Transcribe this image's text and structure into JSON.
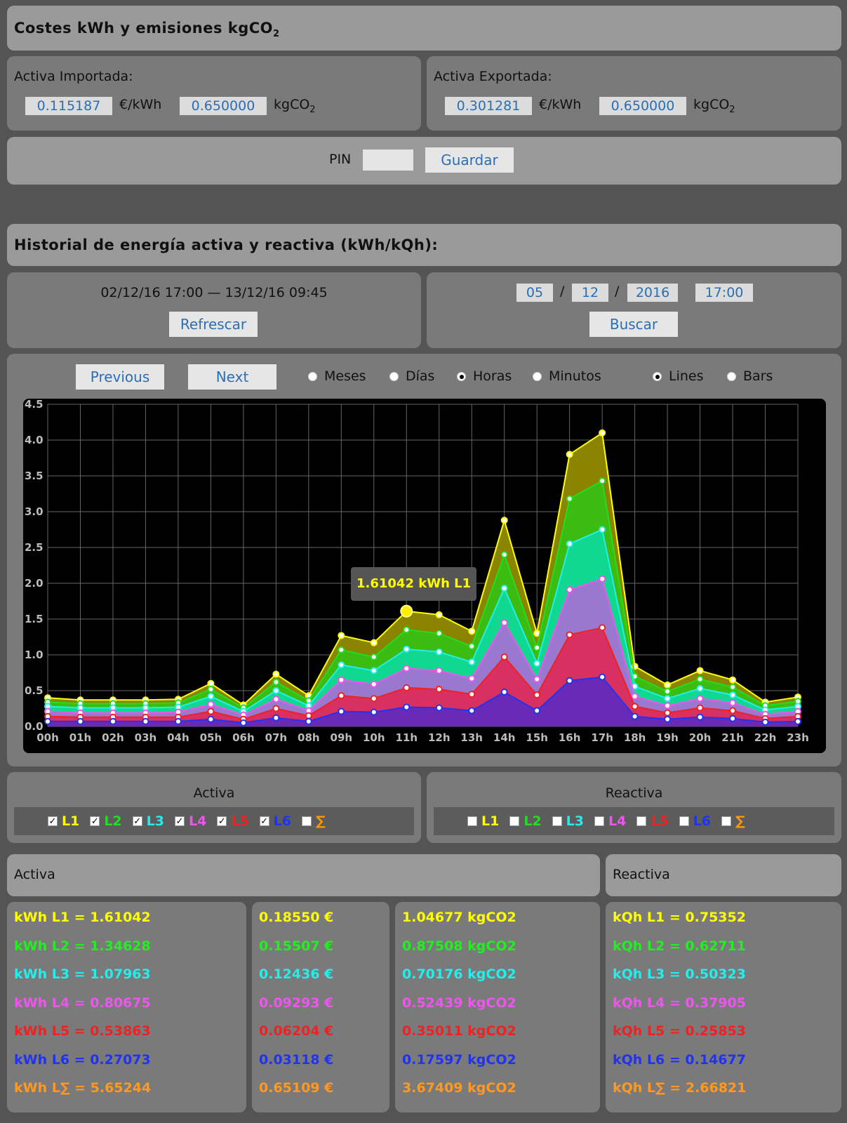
{
  "costes": {
    "title": "Costes kWh y emisiones kgCO",
    "title_sub": "2",
    "import_label": "Activa Importada:",
    "import_price": "0.115187",
    "import_co2": "0.650000",
    "export_label": "Activa Exportada:",
    "export_price": "0.301281",
    "export_co2": "0.650000",
    "unit_price": "€/kWh",
    "unit_co2": "kgCO",
    "unit_co2_sub": "2"
  },
  "pin": {
    "label": "PIN",
    "value": "",
    "save": "Guardar"
  },
  "historial": {
    "title": "Historial de energía activa y reactiva (kWh/kQh):",
    "range": "02/12/16 17:00 — 13/12/16 09:45",
    "refresh": "Refrescar",
    "day": "05",
    "month": "12",
    "year": "2016",
    "time": "17:00",
    "sep": "/",
    "search": "Buscar"
  },
  "controls": {
    "previous": "Previous",
    "next": "Next",
    "meses": "Meses",
    "dias": "Días",
    "horas": "Horas",
    "minutos": "Minutos",
    "lines": "Lines",
    "bars": "Bars",
    "selected_period": "Horas",
    "selected_mode": "Lines"
  },
  "tooltip": "1.61042 kWh L1",
  "chart_data": {
    "type": "area",
    "x": [
      "00h",
      "01h",
      "02h",
      "03h",
      "04h",
      "05h",
      "06h",
      "07h",
      "08h",
      "09h",
      "10h",
      "11h",
      "12h",
      "13h",
      "14h",
      "15h",
      "16h",
      "17h",
      "18h",
      "19h",
      "20h",
      "21h",
      "22h",
      "23h"
    ],
    "ylim": [
      0,
      4.5
    ],
    "yticks": [
      "0.0",
      "0.5",
      "1.0",
      "1.5",
      "2.0",
      "2.5",
      "3.0",
      "3.5",
      "4.0",
      "4.5"
    ],
    "grid": true,
    "series": [
      {
        "name": "L1",
        "color": "#ffff00",
        "values": [
          0.4,
          0.37,
          0.37,
          0.37,
          0.38,
          0.6,
          0.3,
          0.73,
          0.43,
          1.27,
          1.17,
          1.61,
          1.56,
          1.33,
          2.88,
          1.3,
          3.8,
          4.1,
          0.84,
          0.58,
          0.78,
          0.65,
          0.34,
          0.41
        ]
      },
      {
        "name": "L2",
        "color": "#22dd22",
        "values": [
          0.34,
          0.32,
          0.32,
          0.32,
          0.33,
          0.52,
          0.26,
          0.62,
          0.36,
          1.07,
          0.97,
          1.35,
          1.3,
          1.12,
          2.4,
          1.1,
          3.18,
          3.43,
          0.7,
          0.49,
          0.66,
          0.55,
          0.29,
          0.35
        ]
      },
      {
        "name": "L3",
        "color": "#22eeee",
        "values": [
          0.28,
          0.26,
          0.26,
          0.26,
          0.27,
          0.42,
          0.21,
          0.5,
          0.29,
          0.86,
          0.78,
          1.08,
          1.04,
          0.9,
          1.93,
          0.88,
          2.55,
          2.75,
          0.56,
          0.39,
          0.53,
          0.44,
          0.23,
          0.28
        ]
      },
      {
        "name": "L4",
        "color": "#ee55ee",
        "values": [
          0.21,
          0.19,
          0.19,
          0.19,
          0.2,
          0.31,
          0.16,
          0.38,
          0.22,
          0.65,
          0.59,
          0.81,
          0.78,
          0.67,
          1.45,
          0.66,
          1.91,
          2.06,
          0.42,
          0.29,
          0.39,
          0.33,
          0.17,
          0.21
        ]
      },
      {
        "name": "L5",
        "color": "#ee2222",
        "values": [
          0.14,
          0.13,
          0.13,
          0.13,
          0.13,
          0.21,
          0.1,
          0.25,
          0.15,
          0.43,
          0.39,
          0.54,
          0.52,
          0.45,
          0.97,
          0.44,
          1.28,
          1.38,
          0.28,
          0.19,
          0.26,
          0.22,
          0.11,
          0.14
        ]
      },
      {
        "name": "L6",
        "color": "#2233ee",
        "values": [
          0.07,
          0.07,
          0.07,
          0.07,
          0.07,
          0.1,
          0.05,
          0.12,
          0.07,
          0.21,
          0.2,
          0.27,
          0.26,
          0.22,
          0.48,
          0.22,
          0.64,
          0.69,
          0.14,
          0.1,
          0.13,
          0.11,
          0.06,
          0.07
        ]
      }
    ]
  },
  "activa_checks": {
    "title": "Activa",
    "items": [
      {
        "label": "L1",
        "color": "#ffff00",
        "checked": true
      },
      {
        "label": "L2",
        "color": "#22dd22",
        "checked": true
      },
      {
        "label": "L3",
        "color": "#22eeee",
        "checked": true
      },
      {
        "label": "L4",
        "color": "#ee55ee",
        "checked": true
      },
      {
        "label": "L5",
        "color": "#ee2222",
        "checked": true
      },
      {
        "label": "L6",
        "color": "#2233ee",
        "checked": true
      },
      {
        "label": "∑",
        "color": "#ff9900",
        "checked": false
      }
    ]
  },
  "reactiva_checks": {
    "title": "Reactiva",
    "items": [
      {
        "label": "L1",
        "color": "#ffff00",
        "checked": false
      },
      {
        "label": "L2",
        "color": "#22dd22",
        "checked": false
      },
      {
        "label": "L3",
        "color": "#22eeee",
        "checked": false
      },
      {
        "label": "L4",
        "color": "#ee55ee",
        "checked": false
      },
      {
        "label": "L5",
        "color": "#ee2222",
        "checked": false
      },
      {
        "label": "L6",
        "color": "#2233ee",
        "checked": false
      },
      {
        "label": "∑",
        "color": "#ff9900",
        "checked": false
      }
    ]
  },
  "summary": {
    "activa_title": "Activa",
    "reactiva_title": "Reactiva",
    "colors": [
      "#ffff00",
      "#22ee22",
      "#22eeee",
      "#ee55ee",
      "#ee2222",
      "#2233ee",
      "#ff9922"
    ],
    "kwh": [
      "kWh L1 = 1.61042",
      "kWh L2 = 1.34628",
      "kWh L3 = 1.07963",
      "kWh L4 = 0.80675",
      "kWh L5 = 0.53863",
      "kWh L6 = 0.27073",
      "kWh L∑ = 5.65244"
    ],
    "eur": [
      "0.18550 €",
      "0.15507 €",
      "0.12436 €",
      "0.09293 €",
      "0.06204 €",
      "0.03118 €",
      "0.65109 €"
    ],
    "co2": [
      "1.04677 kgCO2",
      "0.87508 kgCO2",
      "0.70176 kgCO2",
      "0.52439 kgCO2",
      "0.35011 kgCO2",
      "0.17597 kgCO2",
      "3.67409 kgCO2"
    ],
    "kqh": [
      "kQh L1 = 0.75352",
      "kQh L2 = 0.62711",
      "kQh L3 = 0.50323",
      "kQh L4 = 0.37905",
      "kQh L5 = 0.25853",
      "kQh L6 = 0.14677",
      "kQh L∑ = 2.66821"
    ]
  }
}
